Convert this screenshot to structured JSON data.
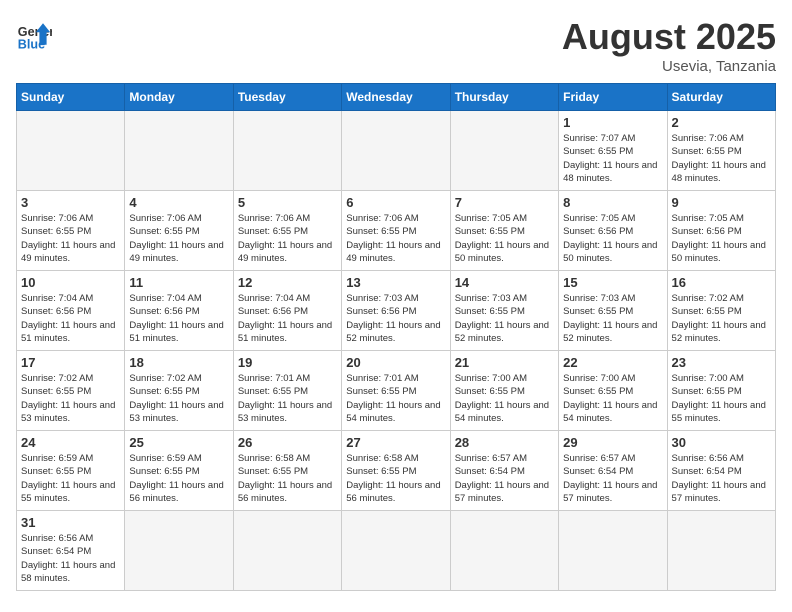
{
  "header": {
    "logo_general": "General",
    "logo_blue": "Blue",
    "month_title": "August 2025",
    "location": "Usevia, Tanzania"
  },
  "days_of_week": [
    "Sunday",
    "Monday",
    "Tuesday",
    "Wednesday",
    "Thursday",
    "Friday",
    "Saturday"
  ],
  "weeks": [
    [
      {
        "day": "",
        "empty": true
      },
      {
        "day": "",
        "empty": true
      },
      {
        "day": "",
        "empty": true
      },
      {
        "day": "",
        "empty": true
      },
      {
        "day": "",
        "empty": true
      },
      {
        "day": "1",
        "sunrise": "7:07 AM",
        "sunset": "6:55 PM",
        "daylight": "11 hours and 48 minutes."
      },
      {
        "day": "2",
        "sunrise": "7:06 AM",
        "sunset": "6:55 PM",
        "daylight": "11 hours and 48 minutes."
      }
    ],
    [
      {
        "day": "3",
        "sunrise": "7:06 AM",
        "sunset": "6:55 PM",
        "daylight": "11 hours and 49 minutes."
      },
      {
        "day": "4",
        "sunrise": "7:06 AM",
        "sunset": "6:55 PM",
        "daylight": "11 hours and 49 minutes."
      },
      {
        "day": "5",
        "sunrise": "7:06 AM",
        "sunset": "6:55 PM",
        "daylight": "11 hours and 49 minutes."
      },
      {
        "day": "6",
        "sunrise": "7:06 AM",
        "sunset": "6:55 PM",
        "daylight": "11 hours and 49 minutes."
      },
      {
        "day": "7",
        "sunrise": "7:05 AM",
        "sunset": "6:55 PM",
        "daylight": "11 hours and 50 minutes."
      },
      {
        "day": "8",
        "sunrise": "7:05 AM",
        "sunset": "6:56 PM",
        "daylight": "11 hours and 50 minutes."
      },
      {
        "day": "9",
        "sunrise": "7:05 AM",
        "sunset": "6:56 PM",
        "daylight": "11 hours and 50 minutes."
      }
    ],
    [
      {
        "day": "10",
        "sunrise": "7:04 AM",
        "sunset": "6:56 PM",
        "daylight": "11 hours and 51 minutes."
      },
      {
        "day": "11",
        "sunrise": "7:04 AM",
        "sunset": "6:56 PM",
        "daylight": "11 hours and 51 minutes."
      },
      {
        "day": "12",
        "sunrise": "7:04 AM",
        "sunset": "6:56 PM",
        "daylight": "11 hours and 51 minutes."
      },
      {
        "day": "13",
        "sunrise": "7:03 AM",
        "sunset": "6:56 PM",
        "daylight": "11 hours and 52 minutes."
      },
      {
        "day": "14",
        "sunrise": "7:03 AM",
        "sunset": "6:55 PM",
        "daylight": "11 hours and 52 minutes."
      },
      {
        "day": "15",
        "sunrise": "7:03 AM",
        "sunset": "6:55 PM",
        "daylight": "11 hours and 52 minutes."
      },
      {
        "day": "16",
        "sunrise": "7:02 AM",
        "sunset": "6:55 PM",
        "daylight": "11 hours and 52 minutes."
      }
    ],
    [
      {
        "day": "17",
        "sunrise": "7:02 AM",
        "sunset": "6:55 PM",
        "daylight": "11 hours and 53 minutes."
      },
      {
        "day": "18",
        "sunrise": "7:02 AM",
        "sunset": "6:55 PM",
        "daylight": "11 hours and 53 minutes."
      },
      {
        "day": "19",
        "sunrise": "7:01 AM",
        "sunset": "6:55 PM",
        "daylight": "11 hours and 53 minutes."
      },
      {
        "day": "20",
        "sunrise": "7:01 AM",
        "sunset": "6:55 PM",
        "daylight": "11 hours and 54 minutes."
      },
      {
        "day": "21",
        "sunrise": "7:00 AM",
        "sunset": "6:55 PM",
        "daylight": "11 hours and 54 minutes."
      },
      {
        "day": "22",
        "sunrise": "7:00 AM",
        "sunset": "6:55 PM",
        "daylight": "11 hours and 54 minutes."
      },
      {
        "day": "23",
        "sunrise": "7:00 AM",
        "sunset": "6:55 PM",
        "daylight": "11 hours and 55 minutes."
      }
    ],
    [
      {
        "day": "24",
        "sunrise": "6:59 AM",
        "sunset": "6:55 PM",
        "daylight": "11 hours and 55 minutes."
      },
      {
        "day": "25",
        "sunrise": "6:59 AM",
        "sunset": "6:55 PM",
        "daylight": "11 hours and 56 minutes."
      },
      {
        "day": "26",
        "sunrise": "6:58 AM",
        "sunset": "6:55 PM",
        "daylight": "11 hours and 56 minutes."
      },
      {
        "day": "27",
        "sunrise": "6:58 AM",
        "sunset": "6:55 PM",
        "daylight": "11 hours and 56 minutes."
      },
      {
        "day": "28",
        "sunrise": "6:57 AM",
        "sunset": "6:54 PM",
        "daylight": "11 hours and 57 minutes."
      },
      {
        "day": "29",
        "sunrise": "6:57 AM",
        "sunset": "6:54 PM",
        "daylight": "11 hours and 57 minutes."
      },
      {
        "day": "30",
        "sunrise": "6:56 AM",
        "sunset": "6:54 PM",
        "daylight": "11 hours and 57 minutes."
      }
    ],
    [
      {
        "day": "31",
        "sunrise": "6:56 AM",
        "sunset": "6:54 PM",
        "daylight": "11 hours and 58 minutes."
      },
      {
        "day": "",
        "empty": true
      },
      {
        "day": "",
        "empty": true
      },
      {
        "day": "",
        "empty": true
      },
      {
        "day": "",
        "empty": true
      },
      {
        "day": "",
        "empty": true
      },
      {
        "day": "",
        "empty": true
      }
    ]
  ],
  "labels": {
    "sunrise_label": "Sunrise:",
    "sunset_label": "Sunset:",
    "daylight_label": "Daylight:"
  }
}
